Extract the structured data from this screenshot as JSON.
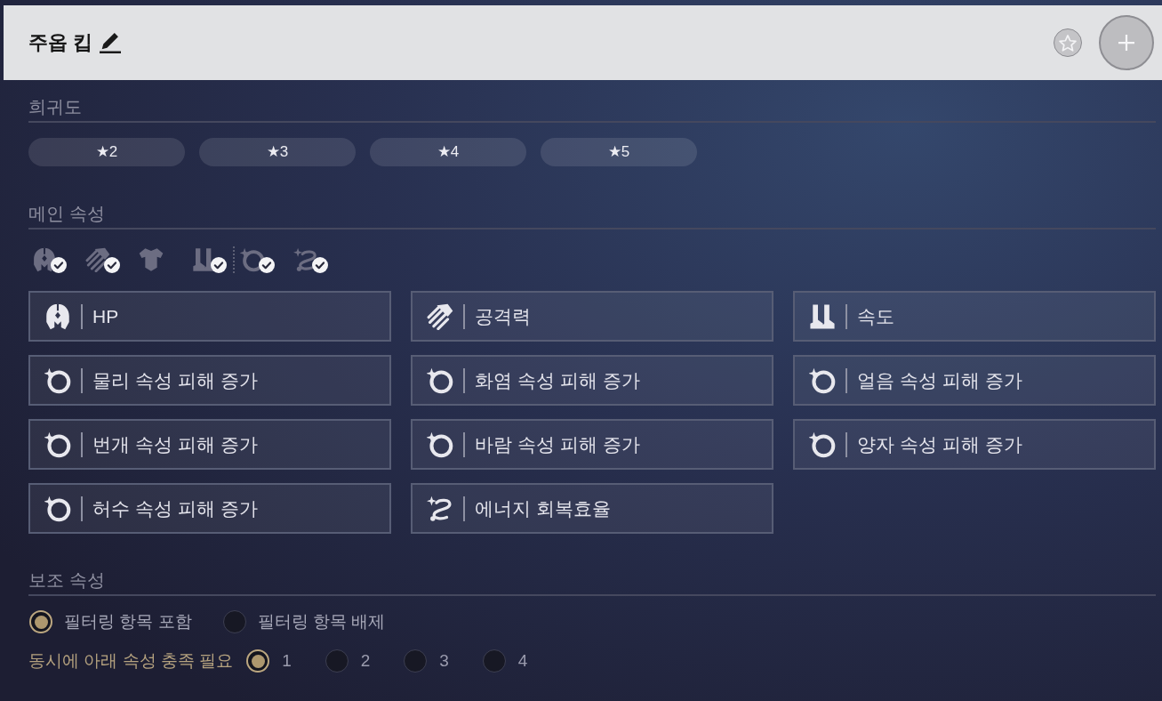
{
  "header": {
    "title": "주옵 킵"
  },
  "rarity": {
    "heading": "희귀도",
    "options": [
      {
        "label": "★2"
      },
      {
        "label": "★3"
      },
      {
        "label": "★4"
      },
      {
        "label": "★5"
      }
    ]
  },
  "main_stats": {
    "heading": "메인 속성",
    "slot_groups": [
      {
        "slots": [
          {
            "kind": "helmet",
            "checked": true
          },
          {
            "kind": "gauntlet",
            "checked": true
          },
          {
            "kind": "armor",
            "checked": false
          },
          {
            "kind": "boots",
            "checked": true
          }
        ]
      },
      {
        "slots": [
          {
            "kind": "ring",
            "checked": true
          },
          {
            "kind": "energy",
            "checked": true
          }
        ]
      }
    ],
    "options": [
      {
        "kind": "helmet",
        "label": "HP"
      },
      {
        "kind": "gauntlet",
        "label": "공격력"
      },
      {
        "kind": "boots",
        "label": "속도"
      },
      {
        "kind": "ring",
        "label": "물리 속성 피해 증가"
      },
      {
        "kind": "ring",
        "label": "화염 속성 피해 증가"
      },
      {
        "kind": "ring",
        "label": "얼음 속성 피해 증가"
      },
      {
        "kind": "ring",
        "label": "번개 속성 피해 증가"
      },
      {
        "kind": "ring",
        "label": "바람 속성 피해 증가"
      },
      {
        "kind": "ring",
        "label": "양자 속성 피해 증가"
      },
      {
        "kind": "ring",
        "label": "허수 속성 피해 증가"
      },
      {
        "kind": "energy",
        "label": "에너지 회복효율"
      }
    ]
  },
  "sub_stats": {
    "heading": "보조 속성",
    "filter_modes": [
      {
        "label": "필터링 항목 포함",
        "selected": true
      },
      {
        "label": "필터링 항목 배제",
        "selected": false
      }
    ],
    "match": {
      "label": "동시에 아래 속성 충족 필요",
      "options": [
        {
          "label": "1",
          "selected": true
        },
        {
          "label": "2",
          "selected": false
        },
        {
          "label": "3",
          "selected": false
        },
        {
          "label": "4",
          "selected": false
        }
      ]
    }
  }
}
